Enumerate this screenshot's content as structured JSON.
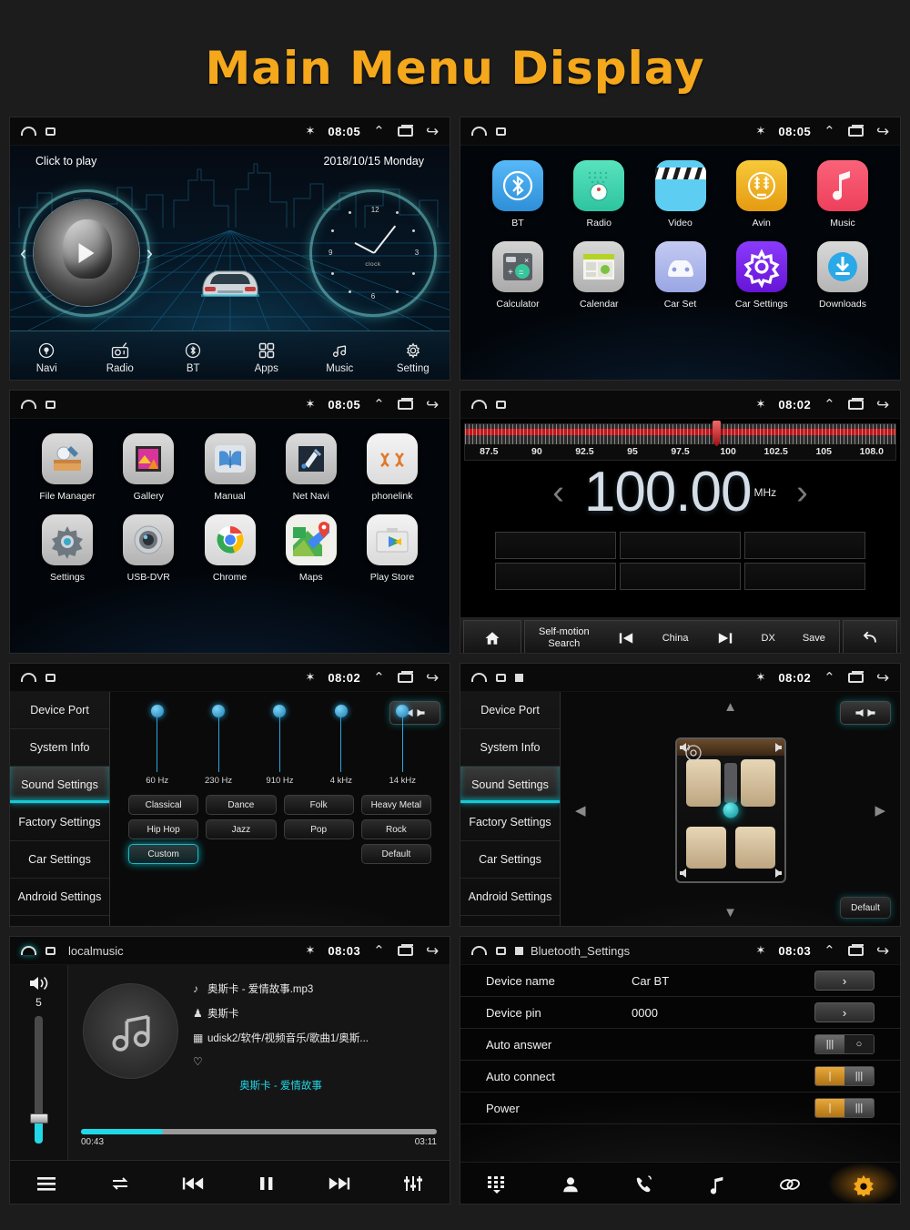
{
  "title": "Main Menu Display",
  "accent": "#f5a81c",
  "statusbar": {
    "home_icon": "home-icon",
    "sd_icon": "sdcard-icon",
    "bt_icon": "bluetooth-icon",
    "chevron_icon": "chevron-up-icon",
    "recents_icon": "recents-icon",
    "back_icon": "back-icon",
    "time_0805": "08:05",
    "time_0802": "08:02",
    "time_0803": "08:03"
  },
  "home": {
    "click_to_play": "Click to play",
    "date": "2018/10/15  Monday",
    "clock_label": "clock",
    "clock_numbers": [
      "12",
      "3",
      "6",
      "9"
    ],
    "nav": [
      {
        "label": "Navi",
        "icon": "location-pin-icon"
      },
      {
        "label": "Radio",
        "icon": "radio-icon"
      },
      {
        "label": "BT",
        "icon": "bluetooth-icon"
      },
      {
        "label": "Apps",
        "icon": "grid-apps-icon"
      },
      {
        "label": "Music",
        "icon": "music-note-icon"
      },
      {
        "label": "Setting",
        "icon": "gear-icon"
      }
    ]
  },
  "apps_page1": {
    "row1": [
      {
        "label": "BT",
        "icon": "bluetooth-app-icon",
        "color": "#3fa9f5"
      },
      {
        "label": "Radio",
        "icon": "radio-app-icon",
        "color": "#3fd6b0"
      },
      {
        "label": "Video",
        "icon": "video-clapper-icon",
        "color": "#4fc8ef"
      },
      {
        "label": "Avin",
        "icon": "avin-icon",
        "color": "#f2b521"
      },
      {
        "label": "Music",
        "icon": "music-app-icon",
        "color": "#f4546b"
      }
    ],
    "row2": [
      {
        "label": "Calculator",
        "icon": "calculator-icon",
        "color": "#b9b9b9"
      },
      {
        "label": "Calendar",
        "icon": "calendar-icon",
        "color": "#c9c9c9"
      },
      {
        "label": "Car Set",
        "icon": "car-set-icon",
        "color": "#aab4e8"
      },
      {
        "label": "Car Settings",
        "icon": "car-settings-icon",
        "color": "#7b2ff7"
      },
      {
        "label": "Downloads",
        "icon": "download-icon",
        "color": "#2aa9e8"
      }
    ]
  },
  "apps_page2": {
    "row1": [
      {
        "label": "File Manager",
        "icon": "file-manager-icon",
        "color": "#c6c6c6"
      },
      {
        "label": "Gallery",
        "icon": "gallery-icon",
        "color": "#c6c6c6"
      },
      {
        "label": "Manual",
        "icon": "manual-book-icon",
        "color": "#c6c6c6"
      },
      {
        "label": "Net Navi",
        "icon": "net-navi-icon",
        "color": "#c6c6c6"
      },
      {
        "label": "phonelink",
        "icon": "phonelink-icon",
        "color": "#e8e8e8"
      }
    ],
    "row2": [
      {
        "label": "Settings",
        "icon": "gear-icon",
        "color": "#c6c6c6"
      },
      {
        "label": "USB-DVR",
        "icon": "dvr-camera-icon",
        "color": "#c6c6c6"
      },
      {
        "label": "Chrome",
        "icon": "chrome-icon",
        "color": "#f1f1f1"
      },
      {
        "label": "Maps",
        "icon": "maps-icon",
        "color": "#f1f1f1"
      },
      {
        "label": "Play Store",
        "icon": "play-store-icon",
        "color": "#f1f1f1"
      }
    ]
  },
  "radio": {
    "frequency": "100.00",
    "unit": "MHz",
    "scale_labels": [
      "87.5",
      "90",
      "92.5",
      "95",
      "97.5",
      "100",
      "102.5",
      "105",
      "108.0"
    ],
    "needle_percent": 57.5,
    "prev_arrow": "‹",
    "next_arrow": "›",
    "presets": [
      "",
      "",
      "",
      "",
      "",
      ""
    ],
    "toolbar": {
      "home_icon": "home-icon",
      "search_label": "Self-motion\nSearch",
      "search_line1": "Self-motion",
      "search_line2": "Search",
      "prev_icon": "skip-prev-icon",
      "band_label": "China",
      "next_icon": "skip-next-icon",
      "dx_label": "DX",
      "save_label": "Save",
      "back_icon": "return-icon"
    }
  },
  "settings_sidebar": [
    "Device Port",
    "System Info",
    "Sound Settings",
    "Factory Settings",
    "Car Settings",
    "Android Settings"
  ],
  "settings_active": "Sound Settings",
  "sound": {
    "speaker_icon": "speaker-balance-icon",
    "bands": [
      {
        "label": "60 Hz",
        "value": 50
      },
      {
        "label": "230 Hz",
        "value": 50
      },
      {
        "label": "910 Hz",
        "value": 50
      },
      {
        "label": "4 kHz",
        "value": 50
      },
      {
        "label": "14 kHz",
        "value": 50
      }
    ],
    "presets_row1": [
      "Classical",
      "Dance",
      "Folk",
      "Heavy Metal"
    ],
    "presets_row2": [
      "Hip Hop",
      "Jazz",
      "Pop",
      "Rock"
    ],
    "presets_row3": [
      "Custom",
      "",
      "",
      "Default"
    ],
    "selected_preset": "Custom"
  },
  "fader": {
    "speaker_icon": "speaker-balance-icon",
    "default_label": "Default",
    "up_icon": "arrow-up-icon",
    "down_icon": "arrow-down-icon",
    "left_icon": "arrow-left-icon",
    "right_icon": "arrow-right-icon",
    "position_icon": "fader-position-icon"
  },
  "music": {
    "app_title": "localmusic",
    "volume_icon": "volume-icon",
    "volume_value": "5",
    "volume_percent": 20,
    "cover_icon": "music-note-icon",
    "track_icon": "music-note-icon",
    "track_name": "奥斯卡 - 爱情故事.mp3",
    "artist_icon": "person-icon",
    "artist": "奥斯卡",
    "path_icon": "usb-icon",
    "path": "udisk2/软件/视频音乐/歌曲1/奥斯...",
    "favorite_icon": "heart-icon",
    "scroll_text": "奥斯卡 - 爱情故事",
    "elapsed": "00:43",
    "duration": "03:11",
    "progress_percent": 23,
    "controls": [
      {
        "icon": "playlist-icon"
      },
      {
        "icon": "repeat-icon"
      },
      {
        "icon": "skip-prev-icon"
      },
      {
        "icon": "pause-icon"
      },
      {
        "icon": "skip-next-icon"
      },
      {
        "icon": "equalizer-icon"
      }
    ]
  },
  "bluetooth": {
    "app_title": "Bluetooth_Settings",
    "rows": [
      {
        "label": "Device name",
        "value": "Car BT",
        "control": "arrow"
      },
      {
        "label": "Device pin",
        "value": "0000",
        "control": "arrow"
      },
      {
        "label": "Auto answer",
        "value": "",
        "control": "toggle",
        "state": "off"
      },
      {
        "label": "Auto connect",
        "value": "",
        "control": "toggle",
        "state": "on"
      },
      {
        "label": "Power",
        "value": "",
        "control": "toggle",
        "state": "on"
      }
    ],
    "arrow_glyph": "›",
    "toolbar": [
      {
        "icon": "dialpad-icon",
        "active": false
      },
      {
        "icon": "contacts-icon",
        "active": false
      },
      {
        "icon": "call-log-icon",
        "active": false
      },
      {
        "icon": "bt-music-icon",
        "active": false
      },
      {
        "icon": "link-icon",
        "active": false
      },
      {
        "icon": "gear-icon",
        "active": true
      }
    ]
  }
}
